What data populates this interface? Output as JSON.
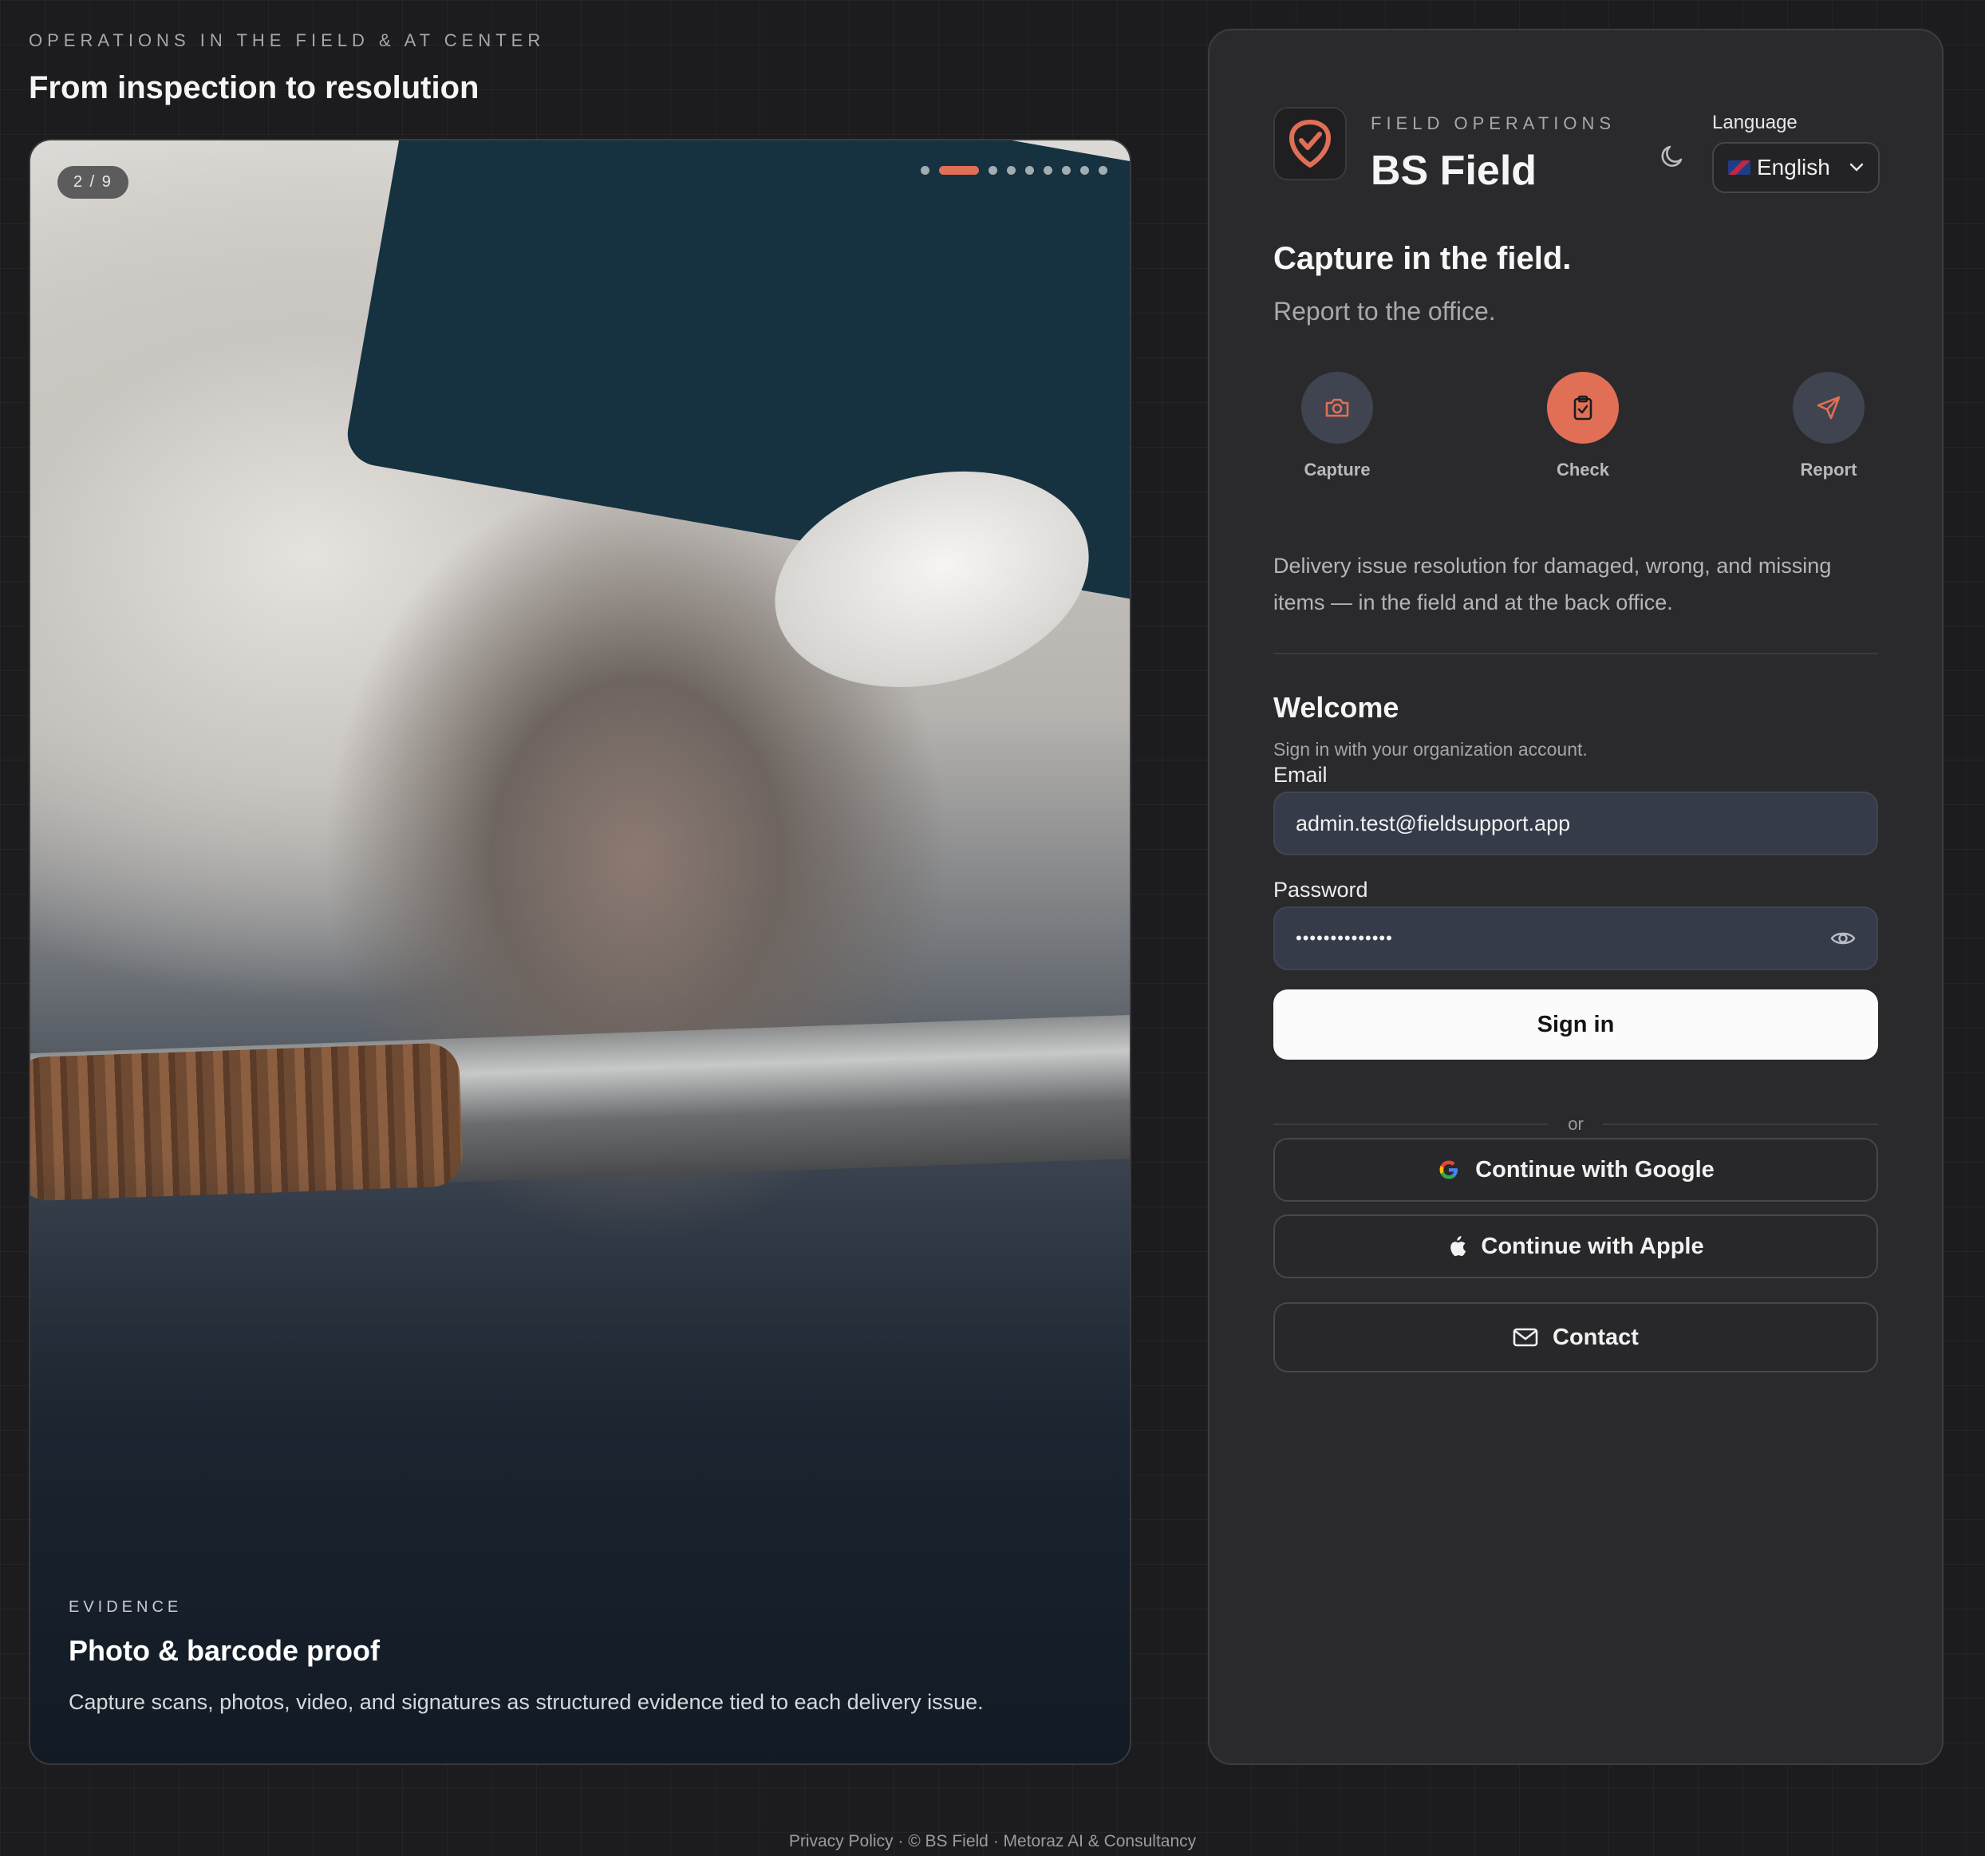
{
  "hero": {
    "eyebrow": "OPERATIONS IN THE FIELD & AT CENTER",
    "title": "From inspection to resolution"
  },
  "slider": {
    "counter": "2 / 9",
    "active_index": 2,
    "total": 9,
    "caption_eyebrow": "EVIDENCE",
    "caption_title": "Photo & barcode proof",
    "caption_desc": "Capture scans, photos, video, and signatures as structured evidence tied to each delivery issue."
  },
  "brand": {
    "eyebrow": "FIELD OPERATIONS",
    "name": "BS Field",
    "accent_color": "#e06f56"
  },
  "language": {
    "label": "Language",
    "selected": "English",
    "flag_icon": "uk-flag-icon"
  },
  "intro": {
    "headline": "Capture in the field.",
    "subhead": "Report to the office.",
    "steps": [
      {
        "label": "Capture",
        "icon": "camera-icon"
      },
      {
        "label": "Check",
        "icon": "clipboard-check-icon"
      },
      {
        "label": "Report",
        "icon": "send-icon"
      }
    ],
    "active_step": "Check",
    "description": "Delivery issue resolution for damaged, wrong, and missing items — in the field and at the back office."
  },
  "login": {
    "welcome": "Welcome",
    "welcome_sub": "Sign in with your organization account.",
    "email_label": "Email",
    "email_value": "admin.test@fieldsupport.app",
    "password_label": "Password",
    "password_value": "••••••••••••••",
    "sign_in": "Sign in",
    "or": "or",
    "google": "Continue with Google",
    "apple": "Continue with Apple",
    "contact": "Contact"
  },
  "footer": {
    "privacy": "Privacy Policy",
    "rest": " · © BS Field · Metoraz AI & Consultancy"
  }
}
